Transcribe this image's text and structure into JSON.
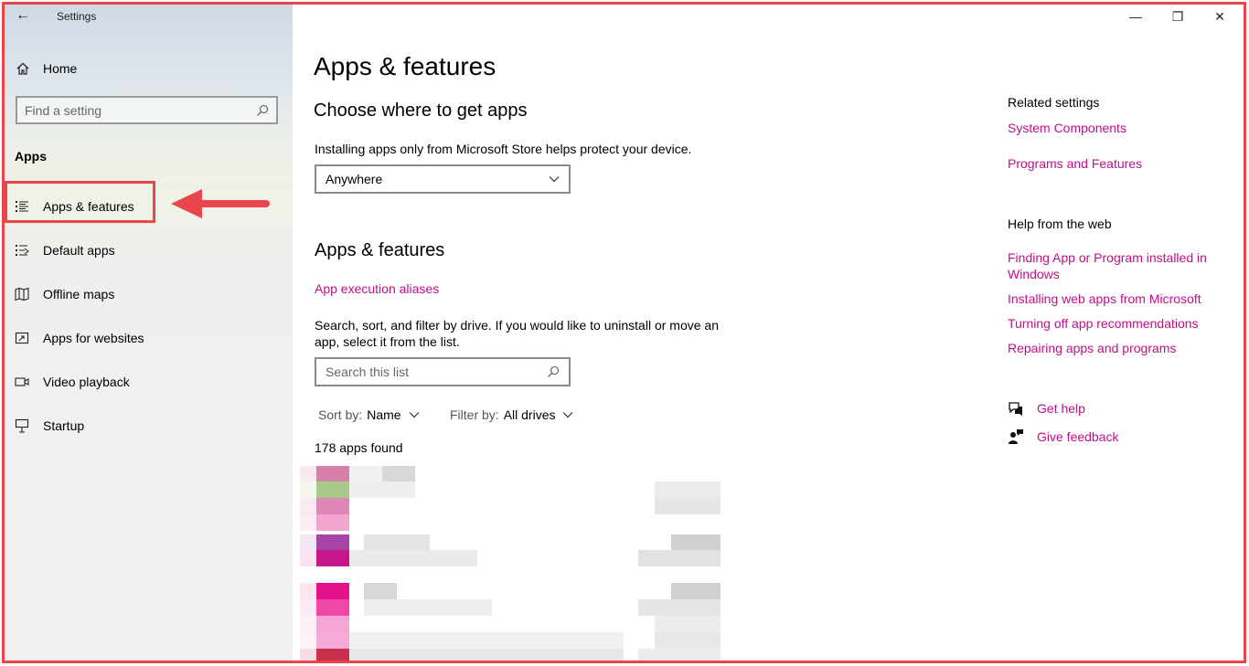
{
  "window": {
    "title": "Settings"
  },
  "sidebar": {
    "home_label": "Home",
    "search_placeholder": "Find a setting",
    "section": "Apps",
    "items": [
      {
        "label": "Apps & features",
        "icon": "list-icon",
        "selected": true
      },
      {
        "label": "Default apps",
        "icon": "default-apps-icon"
      },
      {
        "label": "Offline maps",
        "icon": "map-icon"
      },
      {
        "label": "Apps for websites",
        "icon": "open-in-app-icon"
      },
      {
        "label": "Video playback",
        "icon": "video-icon"
      },
      {
        "label": "Startup",
        "icon": "startup-icon"
      }
    ]
  },
  "main": {
    "title": "Apps & features",
    "choose_heading": "Choose where to get apps",
    "choose_desc": "Installing apps only from Microsoft Store helps protect your device.",
    "source_dropdown": {
      "value": "Anywhere"
    },
    "apps_heading": "Apps & features",
    "alias_link": "App execution aliases",
    "list_desc": "Search, sort, and filter by drive. If you would like to uninstall or move an app, select it from the list.",
    "list_search_placeholder": "Search this list",
    "sort": {
      "key": "Sort by:",
      "value": "Name"
    },
    "filter": {
      "key": "Filter by:",
      "value": "All drives"
    },
    "count_text": "178 apps found"
  },
  "right": {
    "related_heading": "Related settings",
    "related_links": [
      "System Components",
      "Programs and Features"
    ],
    "help_heading": "Help from the web",
    "help_links": [
      "Finding App or Program installed in Windows",
      "Installing web apps from Microsoft",
      "Turning off app recommendations",
      "Repairing apps and programs"
    ],
    "get_help": "Get help",
    "give_feedback": "Give feedback"
  },
  "colors": {
    "accent": "#c20e8a",
    "annotation": "#e8464b",
    "selection_bar": "#c8103e"
  }
}
